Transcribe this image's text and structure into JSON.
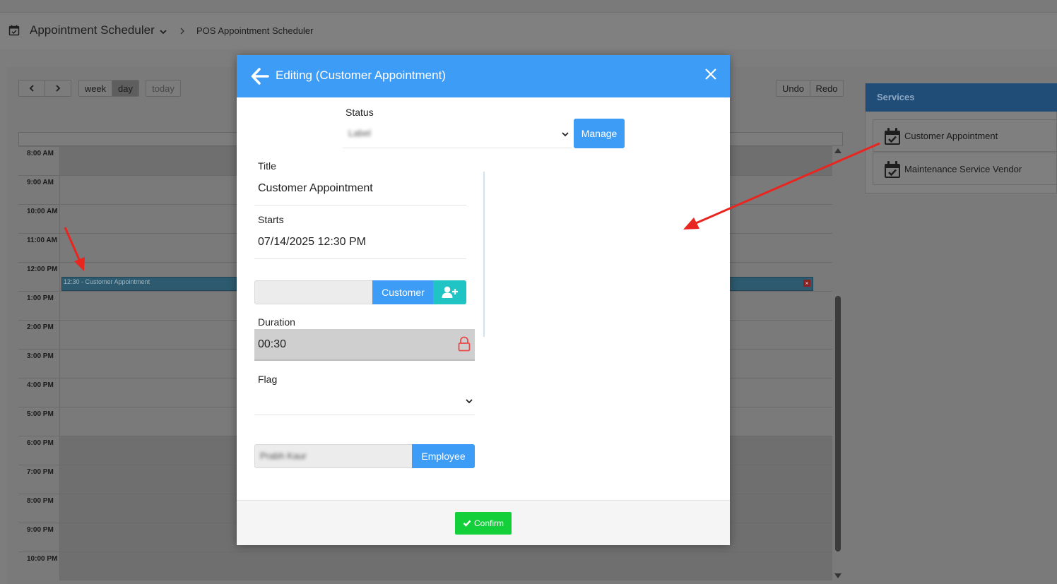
{
  "header": {
    "app_title": "Appointment Scheduler",
    "breadcrumb": "POS Appointment Scheduler"
  },
  "toolbar": {
    "prev_label": "<",
    "next_label": ">",
    "week_label": "week",
    "day_label": "day",
    "today_label": "today",
    "undo_label": "Undo",
    "redo_label": "Redo"
  },
  "calendar": {
    "hours": [
      "8:00 AM",
      "9:00 AM",
      "10:00 AM",
      "11:00 AM",
      "12:00 PM",
      "1:00 PM",
      "2:00 PM",
      "3:00 PM",
      "4:00 PM",
      "5:00 PM",
      "6:00 PM",
      "7:00 PM",
      "8:00 PM",
      "9:00 PM",
      "10:00 PM"
    ],
    "event_label": "12:30 - Customer Appointment",
    "event_close": "×"
  },
  "services": {
    "title": "Services",
    "items": [
      {
        "label": "Customer Appointment",
        "icon": "calendar-check-icon"
      },
      {
        "label": "Maintenance Service Vendor",
        "icon": "calendar-check-icon"
      }
    ]
  },
  "modal": {
    "title": "Editing (Customer Appointment)",
    "status_label": "Status",
    "status_value": "Label",
    "manage_label": "Manage",
    "title_label": "Title",
    "title_value": "Customer Appointment",
    "starts_label": "Starts",
    "starts_value": "07/14/2025 12:30 PM",
    "customer_label": "Customer",
    "duration_label": "Duration",
    "duration_value": "00:30",
    "flag_label": "Flag",
    "employee_value": "Prabh Kaur",
    "employee_label": "Employee",
    "confirm_label": "Confirm"
  },
  "colors": {
    "primary": "#3d9cf5",
    "teal": "#21c4c4",
    "confirm": "#12cf3a",
    "annotation": "#e8251f"
  }
}
